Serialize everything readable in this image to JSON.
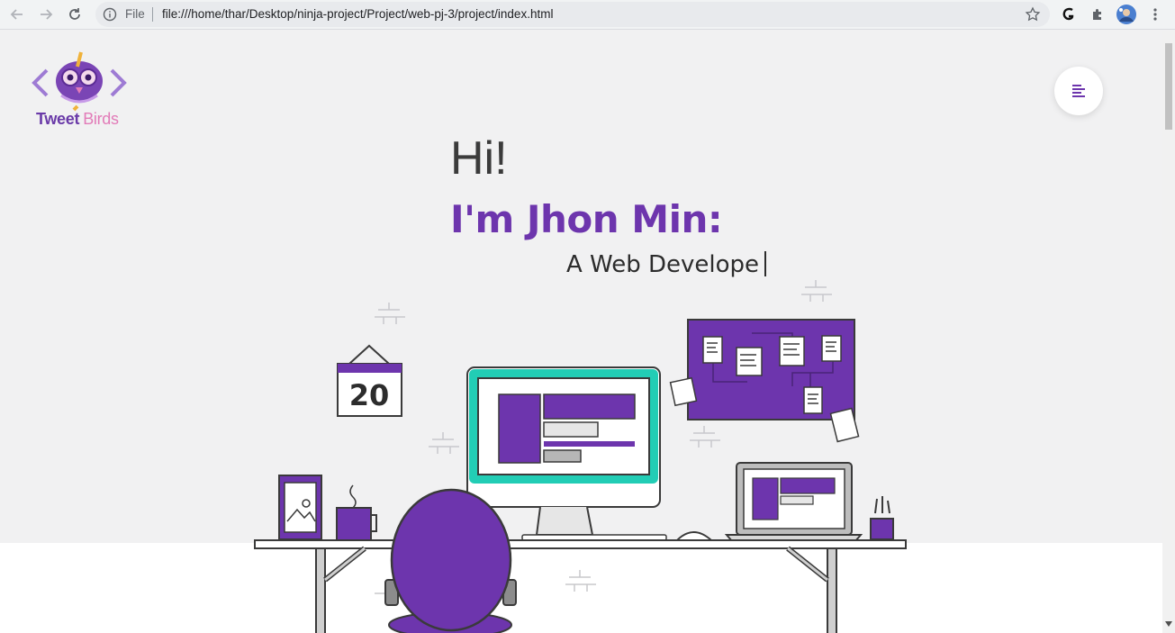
{
  "browser": {
    "scheme_label": "File",
    "url": "file:///home/thar/Desktop/ninja-project/Project/web-pj-3/project/index.html",
    "icons": [
      "back-arrow-icon",
      "forward-arrow-icon",
      "reload-icon",
      "info-icon",
      "star-icon",
      "extension-g-icon",
      "puzzle-extension-icon",
      "profile-avatar",
      "more-menu-icon"
    ]
  },
  "logo": {
    "text_part1": "Tweet",
    "text_part2": "Birds"
  },
  "hero": {
    "greeting": "Hi!",
    "name": "I'm Jhon Min:",
    "role": "A Web Develope"
  },
  "illustration": {
    "calendar_day": "20"
  },
  "colors": {
    "brand_purple": "#6d35ad",
    "accent_teal": "#22cdb5",
    "logo_pink": "#e27bb8",
    "page_bg": "#f1f1f2"
  }
}
